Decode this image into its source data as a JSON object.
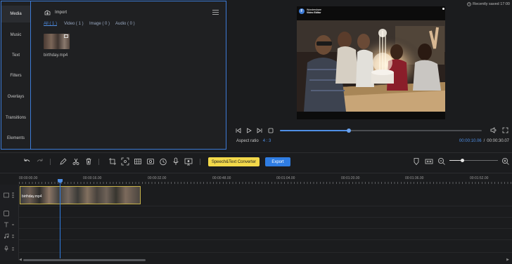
{
  "nav": {
    "media": "Media",
    "music": "Music",
    "text": "Text",
    "filters": "Filters",
    "overlays": "Overlays",
    "transitions": "Transitions",
    "elements": "Elements"
  },
  "media": {
    "import_label": "Import",
    "filters": [
      "All ( 1 )",
      "Video ( 1 )",
      "Image ( 0 )",
      "Audio ( 0 )"
    ],
    "file_name": "birthday.mp4"
  },
  "status": {
    "saved": "Recently saved 17:00"
  },
  "preview": {
    "brand_line1": "Wondershare",
    "brand_line2": "Video Editor"
  },
  "player": {
    "aspect_label": "Aspect ratio",
    "aspect_value": "4 : 3",
    "time_current": "00:00:10.06",
    "time_separator": "/",
    "time_total": "00:00:30.07",
    "progress": 0.34
  },
  "toolbar": {
    "speech_label": "Speech&Text Converter",
    "export_label": "Export",
    "zoom_level": 0.26
  },
  "timeline": {
    "ticks": [
      "00:00:00.00",
      "00:00:16.00",
      "00:00:32.00",
      "00:00:48.00",
      "00:01:04.00",
      "00:01:20.00",
      "00:01:36.00",
      "00:01:52.00"
    ],
    "clip_label": "birthday.mp4"
  },
  "colors": {
    "accent": "#2f7de3",
    "highlight": "#f3d94a",
    "clip_border": "#c7b24a"
  }
}
